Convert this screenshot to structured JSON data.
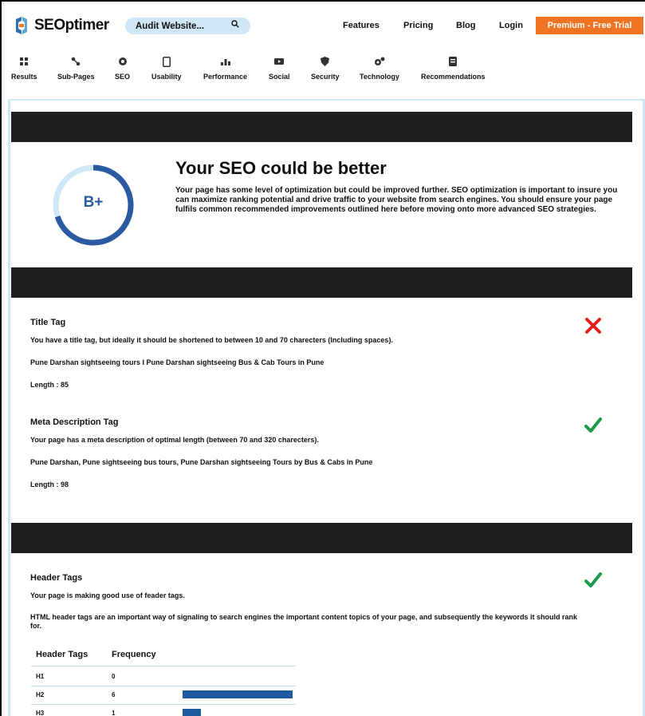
{
  "header": {
    "logo_text": "SEOptimer",
    "audit_label": "Audit Website...",
    "nav": [
      "Features",
      "Pricing",
      "Blog",
      "Login"
    ],
    "premium_label": "Premium - Free Trial"
  },
  "tabs": [
    {
      "label": "Results",
      "icon": "results-icon"
    },
    {
      "label": "Sub-Pages",
      "icon": "subpages-icon"
    },
    {
      "label": "SEO",
      "icon": "seo-icon"
    },
    {
      "label": "Usability",
      "icon": "usability-icon"
    },
    {
      "label": "Performance",
      "icon": "performance-icon"
    },
    {
      "label": "Social",
      "icon": "social-icon"
    },
    {
      "label": "Security",
      "icon": "security-icon"
    },
    {
      "label": "Technology",
      "icon": "technology-icon"
    },
    {
      "label": "Recommendations",
      "icon": "recommendations-icon"
    }
  ],
  "grade": {
    "value": "B+",
    "score_fraction": 0.7,
    "title": "Your SEO could be better",
    "text": "Your page has some level of optimization but could be improved further. SEO optimization is important to insure you can maximize ranking potential and drive traffic to your website from search engines. You should ensure your page fulfils common recommended improvements outlined here before moving onto more advanced SEO strategies."
  },
  "title_tag": {
    "title": "Title Tag",
    "status": "fail",
    "message": "You have a title tag, but ideally it should be shortened to between 10 and 70 charecters (Including spaces).",
    "value": "Pune Darshan sightseeing tours I Pune Darshan sightseeing Bus & Cab Tours in Pune",
    "length": "Length : 85"
  },
  "meta_description": {
    "title": "Meta Description Tag",
    "status": "pass",
    "message": "Your page has a meta description of optimal length (between 70 and 320 charecters).",
    "value": "Pune Darshan, Pune sightseeing bus tours, Pune Darshan sightseeing Tours by Bus & Cabs in Pune",
    "length": "Length : 98"
  },
  "header_tags": {
    "title": "Header Tags",
    "status": "pass",
    "message": "Your page is making good use of feader tags.",
    "description": "HTML header tags are an important way of signaling to search engines the important content topics of your page, and subsequently the keywords it should rank for.",
    "table_headers": [
      "Header Tags",
      "Frequency"
    ],
    "rows": [
      {
        "tag": "H1",
        "frequency": "0",
        "bar_fraction": 0
      },
      {
        "tag": "H2",
        "frequency": "6",
        "bar_fraction": 1.0
      },
      {
        "tag": "H3",
        "frequency": "1",
        "bar_fraction": 0.17
      }
    ]
  },
  "colors": {
    "accent_orange": "#f07422",
    "search_bg": "#cfe6f6",
    "grade_ring": "#2c5aa0",
    "grade_ring_light": "#cfe6f6",
    "fail_red": "#e02020",
    "pass_green": "#1a9a4a",
    "band_dark": "#1f1f1f"
  }
}
